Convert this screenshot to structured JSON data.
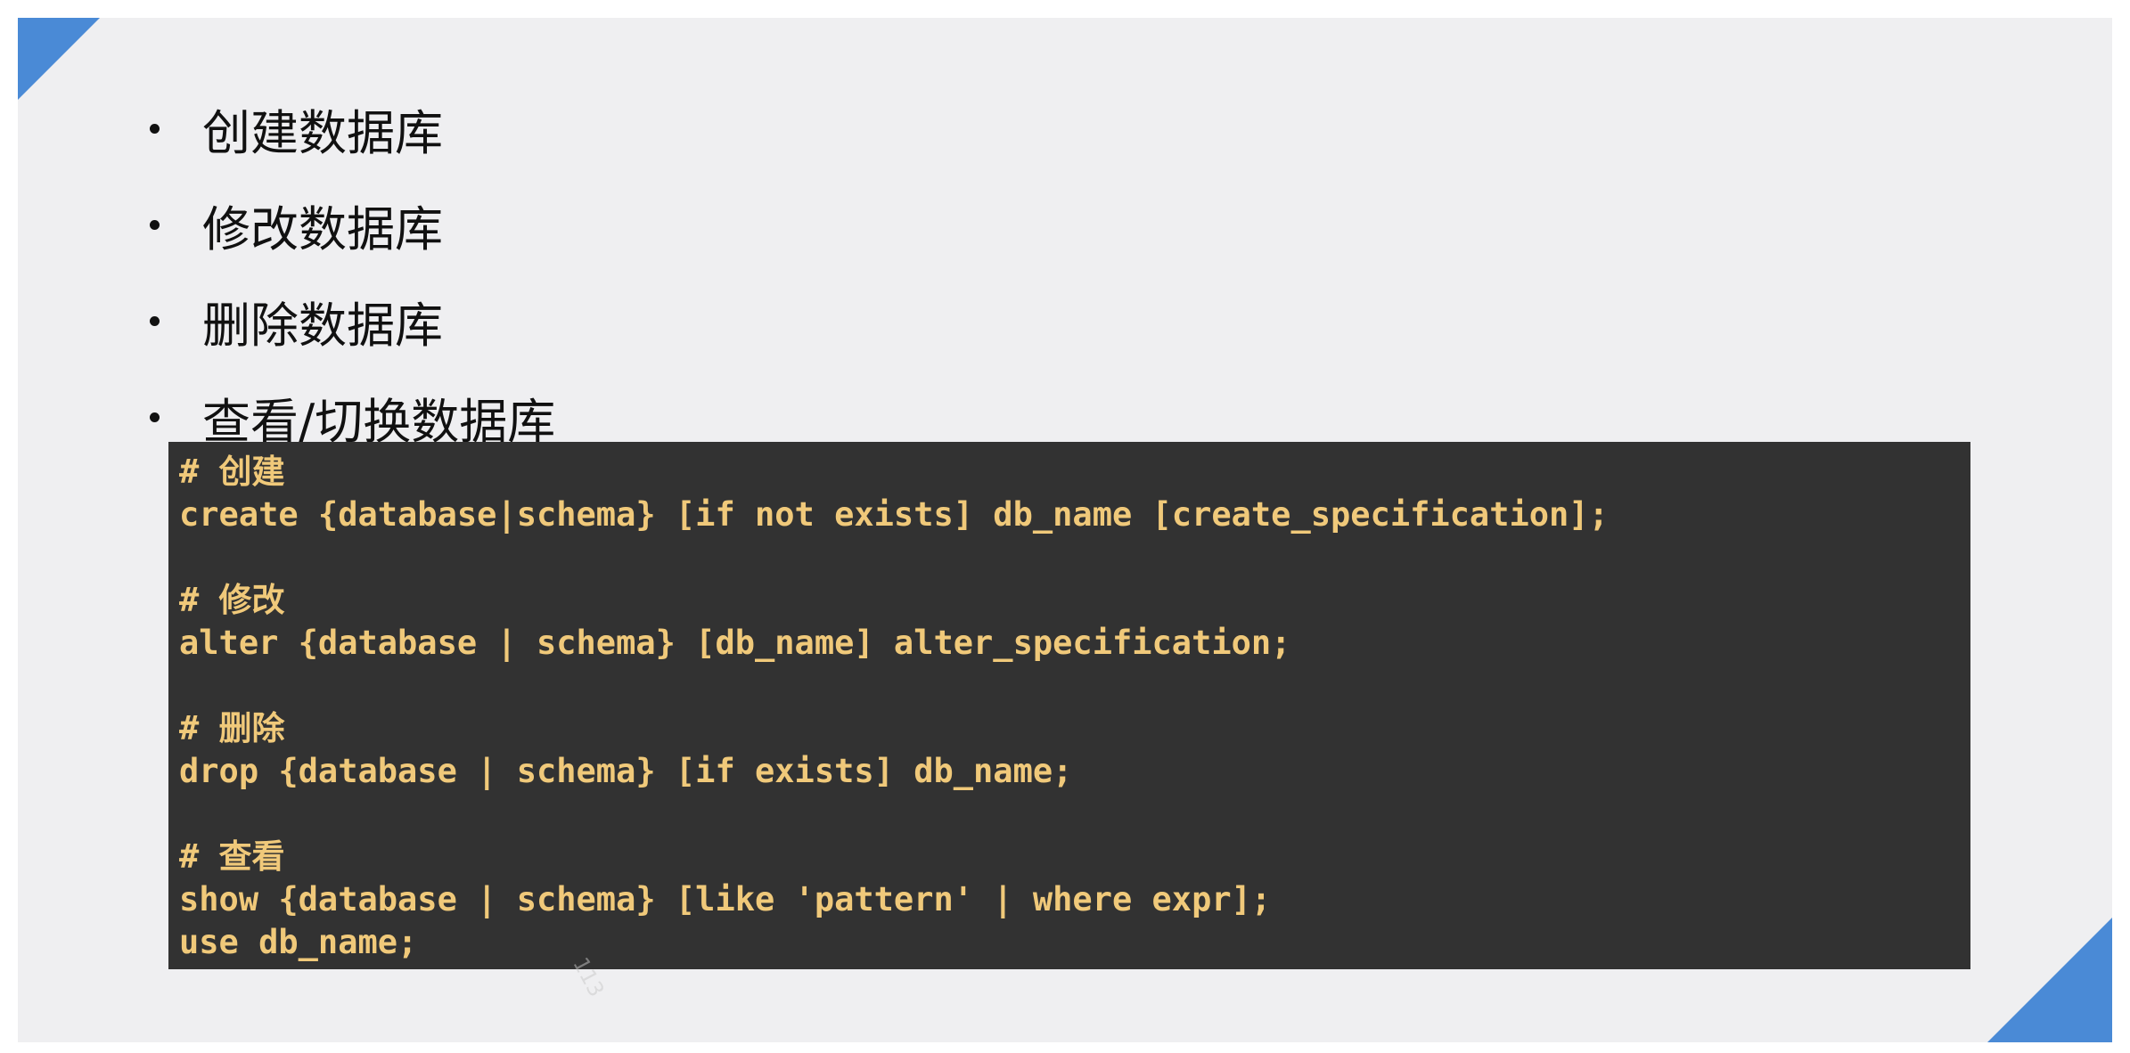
{
  "bullets": [
    "创建数据库",
    "修改数据库",
    "删除数据库",
    "查看/切换数据库"
  ],
  "code": [
    {
      "comment": "# 创建",
      "lines": [
        "create {database|schema} [if not exists] db_name [create_specification];"
      ]
    },
    {
      "comment": "# 修改",
      "lines": [
        "alter {database | schema} [db_name] alter_specification;"
      ]
    },
    {
      "comment": "# 删除",
      "lines": [
        "drop {database | schema} [if exists] db_name;"
      ]
    },
    {
      "comment": "# 查看",
      "lines": [
        "show {database | schema} [like 'pattern' | where expr];",
        "use db_name;"
      ]
    }
  ],
  "watermark": "113",
  "colors": {
    "slide_background": "#efeff1",
    "accent": "#4a8ad6",
    "code_background": "#323232",
    "code_text": "#f0c97a"
  }
}
